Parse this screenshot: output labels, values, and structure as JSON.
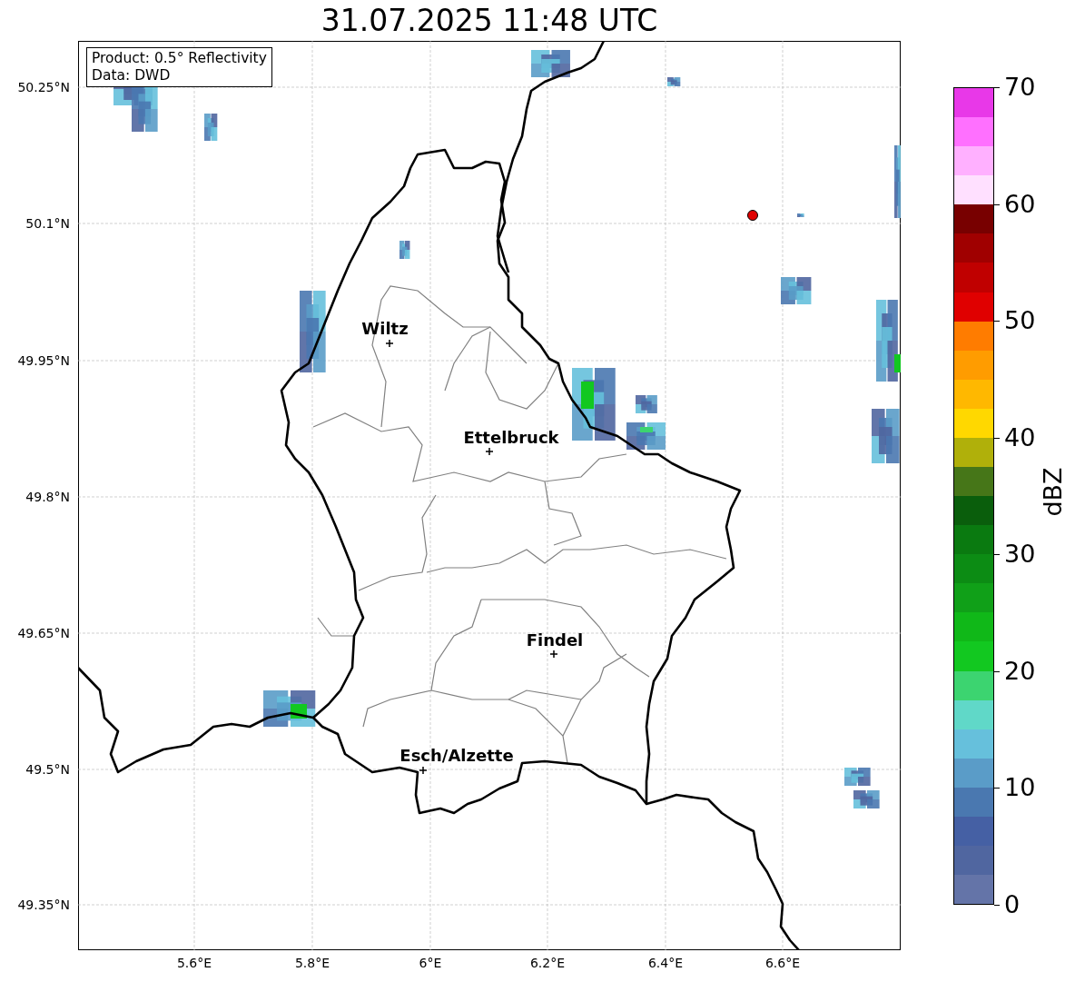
{
  "title": "31.07.2025 11:48 UTC",
  "map": {
    "info_box": [
      "Product: 0.5° Reflectivity",
      "Data: DWD"
    ],
    "latitude_ticks": [
      "50.25°N",
      "50.1°N",
      "49.95°N",
      "49.8°N",
      "49.65°N",
      "49.5°N",
      "49.35°N"
    ],
    "longitude_ticks": [
      "5.6°E",
      "5.8°E",
      "6°E",
      "6.2°E",
      "6.4°E",
      "6.6°E"
    ],
    "cities": [
      "Wiltz",
      "Ettelbruck",
      "Findel",
      "Esch/Alzette"
    ]
  },
  "colorbar": {
    "label": "dBZ",
    "ticks": [
      "70",
      "60",
      "50",
      "40",
      "30",
      "20",
      "10",
      "0"
    ],
    "bins": [
      {
        "color": "#e838e8"
      },
      {
        "color": "#ff70ff"
      },
      {
        "color": "#ffb0ff"
      },
      {
        "color": "#ffe0ff"
      },
      {
        "color": "#780000"
      },
      {
        "color": "#a00000"
      },
      {
        "color": "#c00000"
      },
      {
        "color": "#e00000"
      },
      {
        "color": "#ff7c00"
      },
      {
        "color": "#ff9c00"
      },
      {
        "color": "#ffb800"
      },
      {
        "color": "#ffd800"
      },
      {
        "color": "#b0b00a"
      },
      {
        "color": "#467618"
      },
      {
        "color": "#0a5e0c"
      },
      {
        "color": "#0a7a10"
      },
      {
        "color": "#0c8c14"
      },
      {
        "color": "#10a018"
      },
      {
        "color": "#10b818"
      },
      {
        "color": "#12c820"
      },
      {
        "color": "#3cd470"
      },
      {
        "color": "#60d8c8"
      },
      {
        "color": "#66c0dc"
      },
      {
        "color": "#5a9cc8"
      },
      {
        "color": "#4a78b0"
      },
      {
        "color": "#4560a4"
      },
      {
        "color": "#5066a0"
      },
      {
        "color": "#6474a8"
      }
    ]
  }
}
